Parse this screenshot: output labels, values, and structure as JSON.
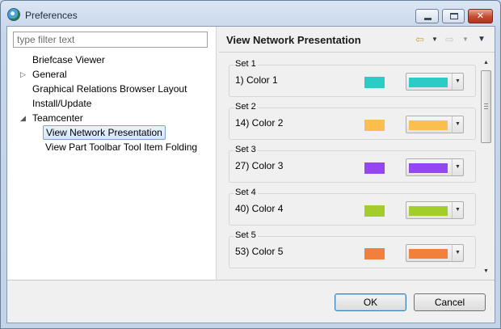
{
  "window": {
    "title": "Preferences",
    "minimize_glyph": "",
    "maximize_glyph": "",
    "close_glyph": "✕"
  },
  "filter": {
    "placeholder": "type filter text",
    "value": ""
  },
  "tree": [
    {
      "label": "Briefcase Viewer",
      "expander": "",
      "level": 0
    },
    {
      "label": "General",
      "expander": "▷",
      "level": 0
    },
    {
      "label": "Graphical Relations Browser Layout",
      "expander": "",
      "level": 0
    },
    {
      "label": "Install/Update",
      "expander": "",
      "level": 0
    },
    {
      "label": "Teamcenter",
      "expander": "◢",
      "level": 0
    },
    {
      "label": "View Network Presentation",
      "expander": "",
      "level": 1,
      "selected": true
    },
    {
      "label": "View Part Toolbar Tool Item Folding",
      "expander": "",
      "level": 1
    }
  ],
  "page": {
    "title": "View Network Presentation",
    "back_icon": "back-arrow-icon",
    "forward_icon": "forward-arrow-icon",
    "back_glyph": "⇦",
    "forward_glyph": "⇨",
    "dropdown_glyph": "▼",
    "menu_glyph": "▼"
  },
  "sets": [
    {
      "title": "Set 1",
      "row": "1) Color 1",
      "color": "#2ccbc5"
    },
    {
      "title": "Set 2",
      "row": "14) Color 2",
      "color": "#fbbf4f"
    },
    {
      "title": "Set 3",
      "row": "27) Color 3",
      "color": "#9446f2"
    },
    {
      "title": "Set 4",
      "row": "40) Color 4",
      "color": "#a2cd2a"
    },
    {
      "title": "Set 5",
      "row": "53) Color 5",
      "color": "#f2803b"
    }
  ],
  "scrollbar": {
    "up_glyph": "▲",
    "down_glyph": "▼"
  },
  "buttons": {
    "ok": "OK",
    "cancel": "Cancel"
  }
}
